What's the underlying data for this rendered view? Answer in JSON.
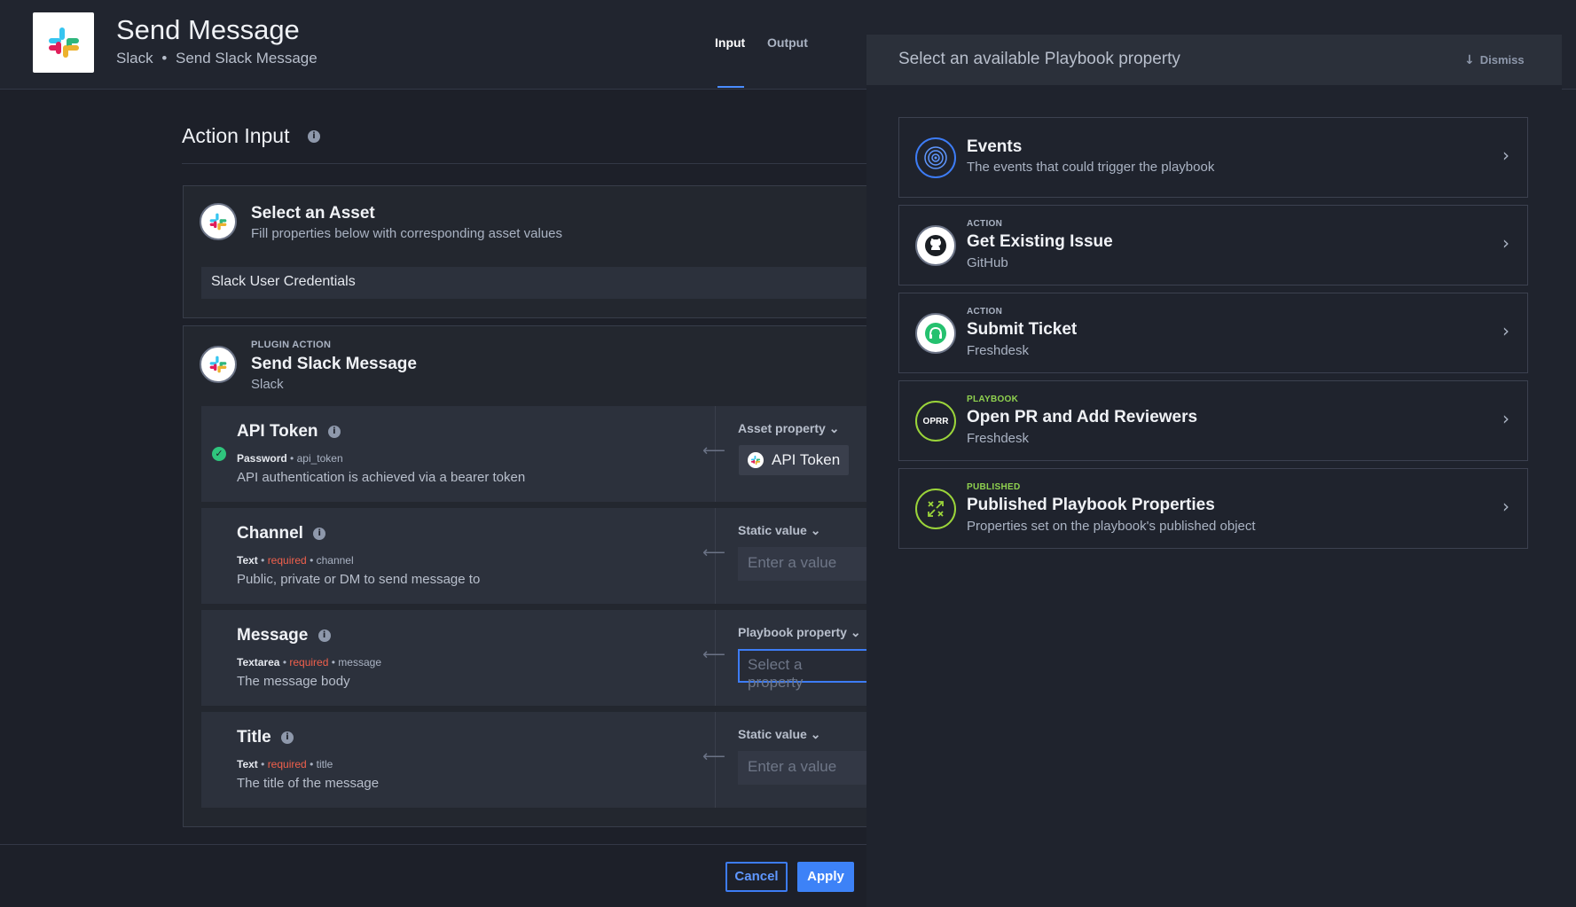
{
  "header": {
    "title": "Send Message",
    "subtitle_app": "Slack",
    "subtitle_sep": "•",
    "subtitle_action": "Send Slack Message",
    "tabs": [
      {
        "label": "Input",
        "active": true
      },
      {
        "label": "Output",
        "active": false
      }
    ]
  },
  "action_input": {
    "title": "Action Input",
    "info_glyph": "i",
    "asset": {
      "title": "Select an Asset",
      "subtitle": "Fill properties below with corresponding asset values",
      "selected": "Slack User Credentials"
    },
    "plugin": {
      "eyebrow": "PLUGIN ACTION",
      "title": "Send Slack Message",
      "subtitle": "Slack"
    },
    "properties": [
      {
        "name": "API Token",
        "type": "Password",
        "required": "",
        "key": "api_token",
        "description": "API authentication is achieved via a bearer token",
        "source": "Asset property",
        "value": "API Token",
        "placeholder": "",
        "complete": true
      },
      {
        "name": "Channel",
        "type": "Text",
        "required": "required",
        "key": "channel",
        "description": "Public, private or DM to send message to",
        "source": "Static value",
        "value": "",
        "placeholder": "Enter a value",
        "complete": false
      },
      {
        "name": "Message",
        "type": "Textarea",
        "required": "required",
        "key": "message",
        "description": "The message body",
        "source": "Playbook property",
        "value": "",
        "placeholder": "Select a property",
        "complete": false
      },
      {
        "name": "Title",
        "type": "Text",
        "required": "required",
        "key": "title",
        "description": "The title of the message",
        "source": "Static value",
        "value": "",
        "placeholder": "Enter a value",
        "complete": false
      }
    ],
    "meta_sep": "•",
    "arrow_glyph": "⟵",
    "chevron_glyph": "⌄"
  },
  "footer": {
    "cancel_label": "Cancel",
    "apply_label": "Apply"
  },
  "playbook_panel": {
    "title": "Select an available Playbook property",
    "dismiss_label": "Dismiss",
    "dismiss_icon": "↓",
    "chevron": "›",
    "items": [
      {
        "eyebrow": "",
        "title": "Events",
        "subtitle": "The events that could trigger the playbook",
        "icon": "target-icon"
      },
      {
        "eyebrow": "ACTION",
        "title": "Get Existing Issue",
        "subtitle": "GitHub",
        "icon": "github-icon"
      },
      {
        "eyebrow": "ACTION",
        "title": "Submit Ticket",
        "subtitle": "Freshdesk",
        "icon": "freshdesk-icon"
      },
      {
        "eyebrow": "PLAYBOOK",
        "title": "Open PR and Add Reviewers",
        "subtitle": "Freshdesk",
        "icon": "oprr-badge",
        "badge": "OPRR"
      },
      {
        "eyebrow": "PUBLISHED",
        "title": "Published Playbook Properties",
        "subtitle": "Properties set on the playbook's published object",
        "icon": "published-icon"
      }
    ]
  },
  "colors": {
    "accent": "#3d82f7",
    "success": "#2fc57d",
    "required": "#f0604c",
    "eyebrow_green": "#8fd14f"
  }
}
